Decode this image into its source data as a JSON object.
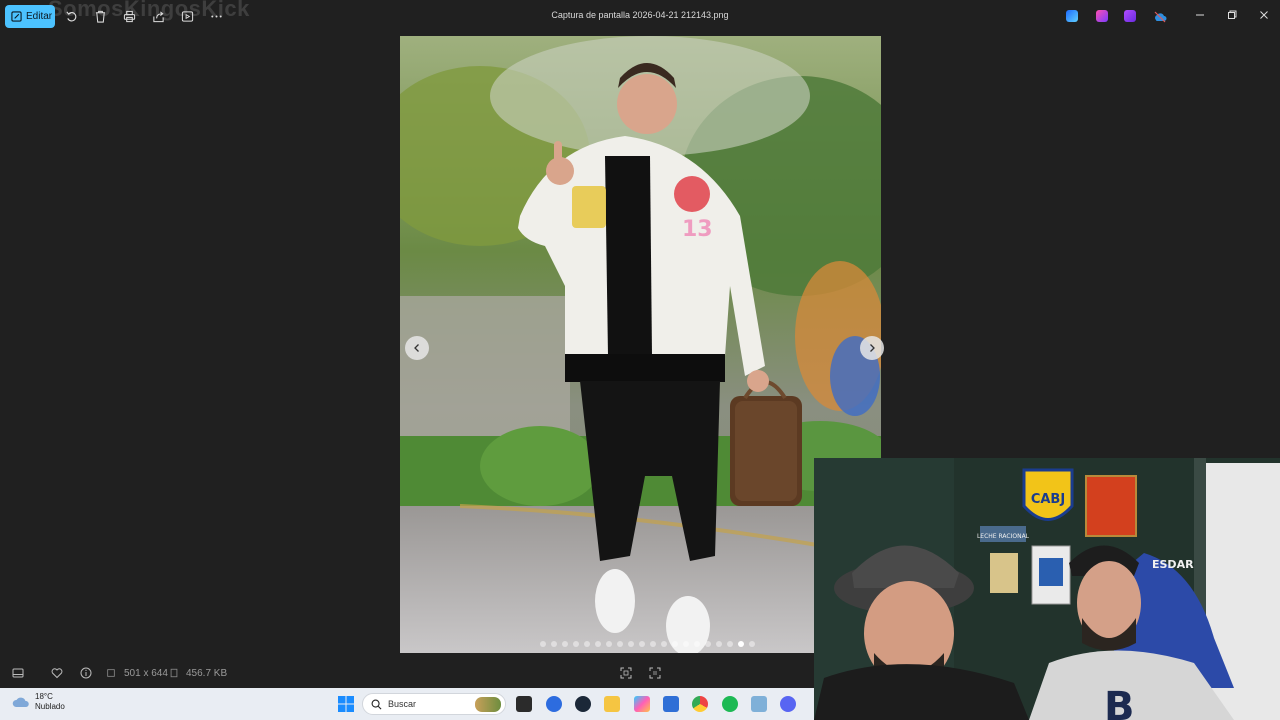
{
  "titlebar": {
    "edit_label": "Editar",
    "title": "Captura de pantalla 2026-04-21 212143.png",
    "watermark": "SomosKingosKick",
    "toolbar_icons": [
      "rotate-icon",
      "delete-icon",
      "print-icon",
      "share-icon",
      "slideshow-icon",
      "more-icon"
    ],
    "tray_apps": [
      "app-blue-icon",
      "app-copilot-icon",
      "app-purple-icon",
      "onedrive-icon"
    ],
    "window_controls": [
      "minimize-icon",
      "restore-icon",
      "close-icon"
    ]
  },
  "viewer": {
    "dots_count": 20,
    "active_dot": 18
  },
  "bottombar": {
    "dimensions": "501 x 644",
    "filesize": "456.7 KB"
  },
  "taskbar": {
    "temperature": "18°C",
    "condition": "Nublado",
    "search_placeholder": "Buscar"
  },
  "webcam": {
    "badge_text": "CABJ",
    "chair_text": "ESDAR",
    "sign_text": "LECHE RACIONAL",
    "shirt_letter": "B"
  },
  "colors": {
    "accent": "#4cc2ff",
    "background": "#202020",
    "taskbar": "#e9edf3"
  }
}
